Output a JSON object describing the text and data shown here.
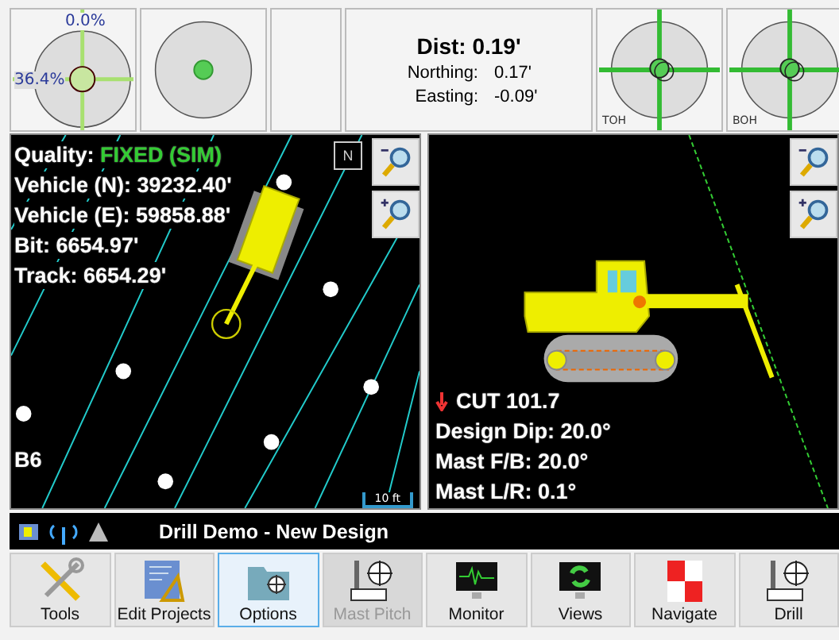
{
  "top_bar": {
    "level_gauge": {
      "top_reading": "0.0%",
      "left_reading": "36.4%"
    },
    "distance": {
      "title": "Dist: 0.19'",
      "rows": [
        {
          "label": "Northing:",
          "value": "0.17'"
        },
        {
          "label": "Easting:",
          "value": "-0.09'"
        }
      ]
    },
    "target_gauges": [
      {
        "label": "TOH"
      },
      {
        "label": "BOH"
      }
    ]
  },
  "plan_view": {
    "quality": {
      "label": "Quality:",
      "value": "FIXED (SIM)"
    },
    "readings": [
      "Vehicle (N): 39232.40'",
      "Vehicle (E): 59858.88'",
      "Bit: 6654.97'",
      "Track: 6654.29'"
    ],
    "north": "N",
    "row_label": "B6",
    "scale": "10 ft"
  },
  "profile_view": {
    "cut": "CUT 101.7",
    "readings": [
      "Design Dip: 20.0°",
      "Mast F/B: 20.0°",
      "Mast L/R: 0.1°"
    ]
  },
  "status_bar": {
    "title": "Drill Demo - New Design"
  },
  "toolbar": [
    {
      "kind": "tools",
      "label": "Tools",
      "selected": false,
      "disabled": false
    },
    {
      "kind": "projects",
      "label": "Edit Projects",
      "selected": false,
      "disabled": false
    },
    {
      "kind": "options",
      "label": "Options",
      "selected": true,
      "disabled": false
    },
    {
      "kind": "drill",
      "label": "Mast Pitch",
      "selected": false,
      "disabled": true
    },
    {
      "kind": "monitor",
      "label": "Monitor",
      "selected": false,
      "disabled": false
    },
    {
      "kind": "views",
      "label": "Views",
      "selected": false,
      "disabled": false
    },
    {
      "kind": "navigate",
      "label": "Navigate",
      "selected": false,
      "disabled": false
    },
    {
      "kind": "drill",
      "label": "Drill",
      "selected": false,
      "disabled": false
    }
  ]
}
